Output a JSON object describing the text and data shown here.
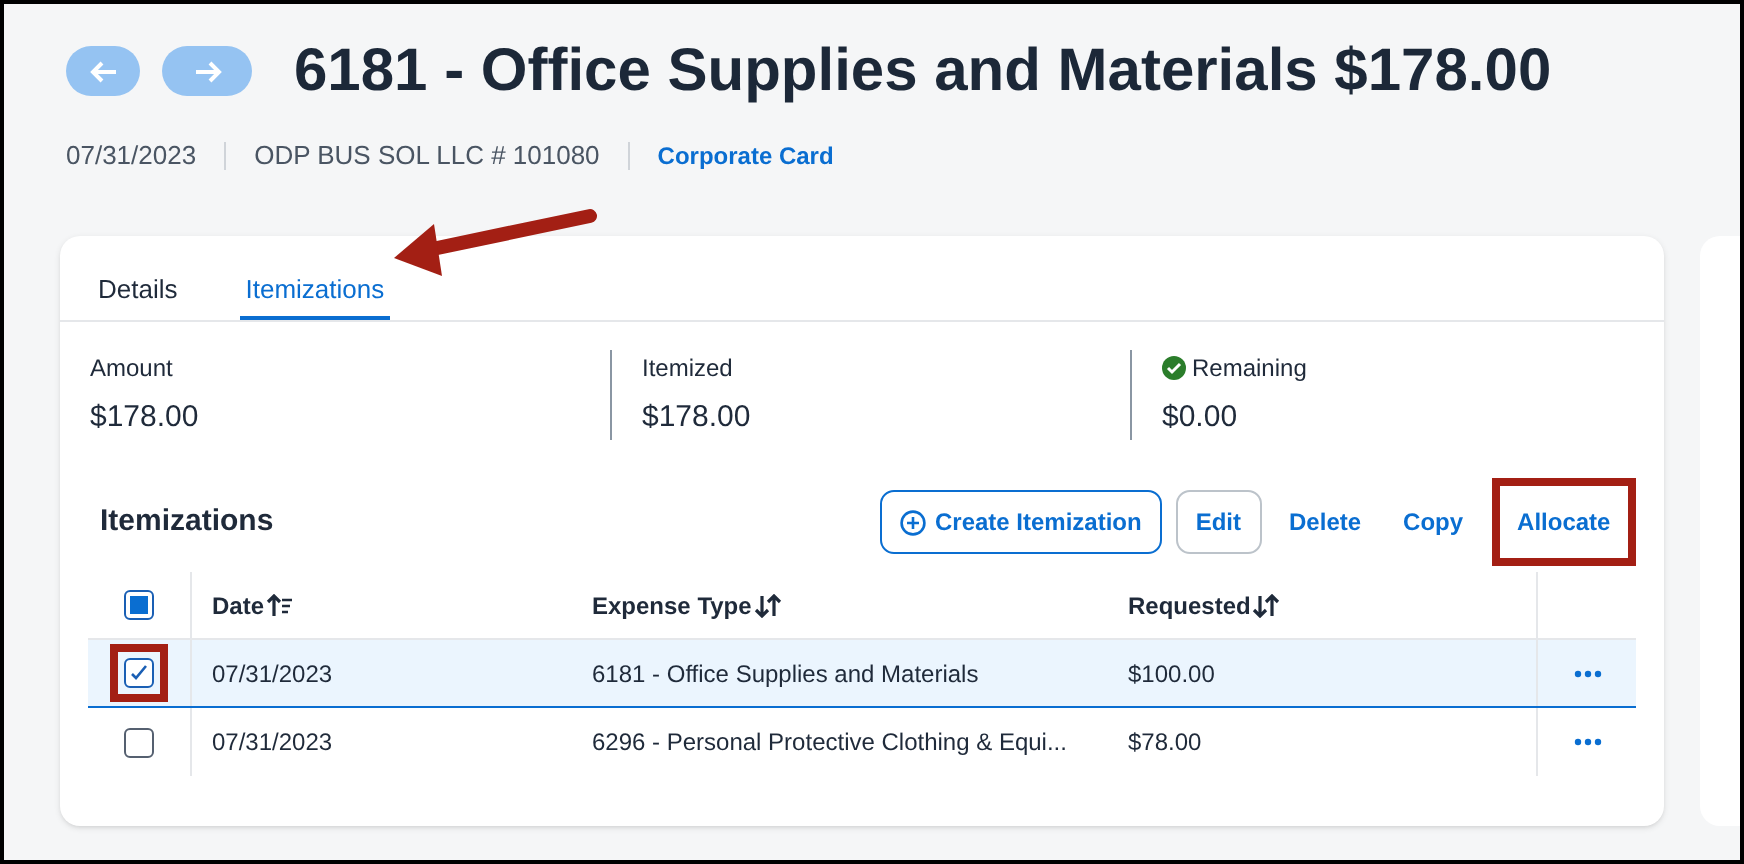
{
  "header": {
    "title": "6181 - Office Supplies and Materials $178.00",
    "date": "07/31/2023",
    "vendor": "ODP BUS SOL LLC # 101080",
    "payment_link": "Corporate Card"
  },
  "tabs": [
    {
      "label": "Details",
      "selected": false
    },
    {
      "label": "Itemizations",
      "selected": true
    }
  ],
  "summary": [
    {
      "label": "Amount",
      "value": "$178.00",
      "ok": false
    },
    {
      "label": "Itemized",
      "value": "$178.00",
      "ok": false
    },
    {
      "label": "Remaining",
      "value": "$0.00",
      "ok": true
    }
  ],
  "section_title": "Itemizations",
  "actions": [
    {
      "label": "Create Itemization",
      "kind": "outlined",
      "highlighted": false
    },
    {
      "label": "Edit",
      "kind": "bordered",
      "highlighted": false
    },
    {
      "label": "Delete",
      "kind": "text",
      "highlighted": false
    },
    {
      "label": "Copy",
      "kind": "text",
      "highlighted": false
    },
    {
      "label": "Allocate",
      "kind": "text",
      "highlighted": true
    }
  ],
  "table": {
    "select_all_indeterminate": true,
    "columns": [
      {
        "label": "Date",
        "sorted": true
      },
      {
        "label": "Expense Type",
        "sorted": false
      },
      {
        "label": "Requested",
        "sorted": false
      }
    ],
    "rows": [
      {
        "date": "07/31/2023",
        "expense_type": "6181 - Office Supplies and Materials",
        "requested": "$100.00",
        "selected": true,
        "highlighted": true
      },
      {
        "date": "07/31/2023",
        "expense_type": "6296 - Personal Protective Clothing & Equi...",
        "requested": "$78.00",
        "selected": false,
        "highlighted": false
      }
    ]
  }
}
